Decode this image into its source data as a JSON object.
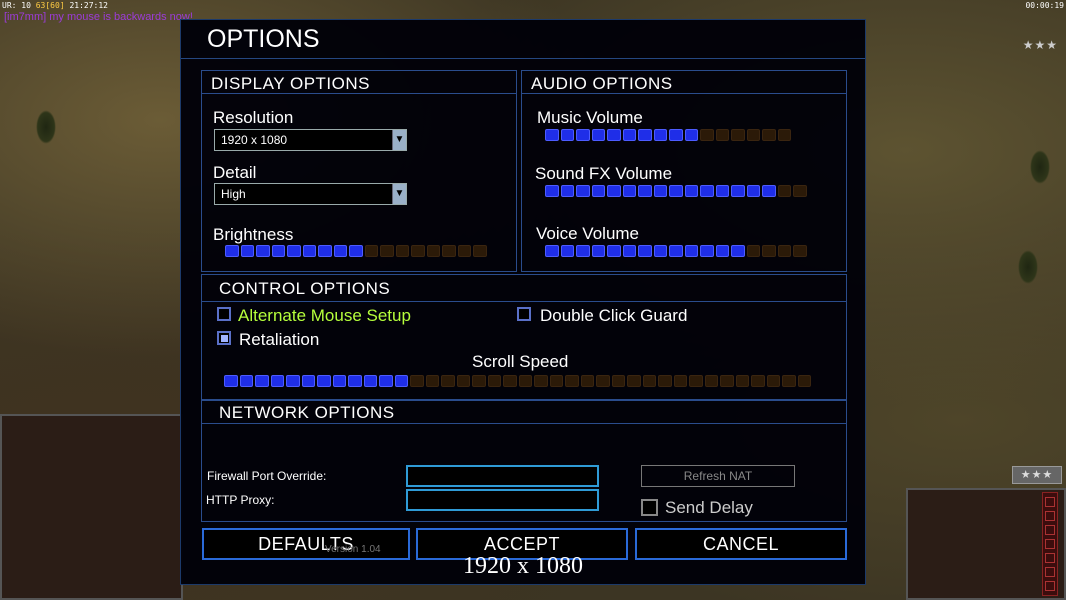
{
  "hud": {
    "status_prefix": "UR: 10",
    "fps": "63[60]",
    "time": "21:27:12",
    "chat": "[im7mm] my mouse is backwards now!",
    "clock": "00:00:19",
    "rank_stars": "★★★"
  },
  "dialog": {
    "title": "OPTIONS",
    "display": {
      "header": "DISPLAY OPTIONS",
      "resolution_label": "Resolution",
      "resolution_value": "1920 x 1080",
      "detail_label": "Detail",
      "detail_value": "High",
      "brightness_label": "Brightness",
      "brightness_level": {
        "filled": 9,
        "total": 17
      }
    },
    "audio": {
      "header": "AUDIO OPTIONS",
      "music_label": "Music Volume",
      "music_level": {
        "filled": 10,
        "total": 16
      },
      "sfx_label": "Sound FX Volume",
      "sfx_level": {
        "filled": 15,
        "total": 17
      },
      "voice_label": "Voice Volume",
      "voice_level": {
        "filled": 13,
        "total": 17
      }
    },
    "control": {
      "header": "CONTROL OPTIONS",
      "alternate_mouse_label": "Alternate Mouse Setup",
      "alternate_mouse_checked": false,
      "double_click_label": "Double Click Guard",
      "double_click_checked": false,
      "retaliation_label": "Retaliation",
      "retaliation_checked": true,
      "scroll_label": "Scroll Speed",
      "scroll_level": {
        "filled": 12,
        "total": 38
      }
    },
    "network": {
      "header": "NETWORK OPTIONS",
      "firewall_label": "Firewall Port Override:",
      "firewall_value": "",
      "proxy_label": "HTTP Proxy:",
      "proxy_value": "",
      "refresh_nat_label": "Refresh NAT",
      "send_delay_label": "Send Delay",
      "send_delay_checked": false
    },
    "buttons": {
      "defaults": "DEFAULTS",
      "accept": "ACCEPT",
      "cancel": "CANCEL"
    },
    "version": "Version 1.04"
  },
  "overlay_resolution": "1920 x 1080",
  "colors": {
    "slider_on": "#1f2ee8",
    "slider_off": "#2b1a08",
    "highlight_text": "#b6ff3c",
    "border": "#2a4c8c"
  }
}
